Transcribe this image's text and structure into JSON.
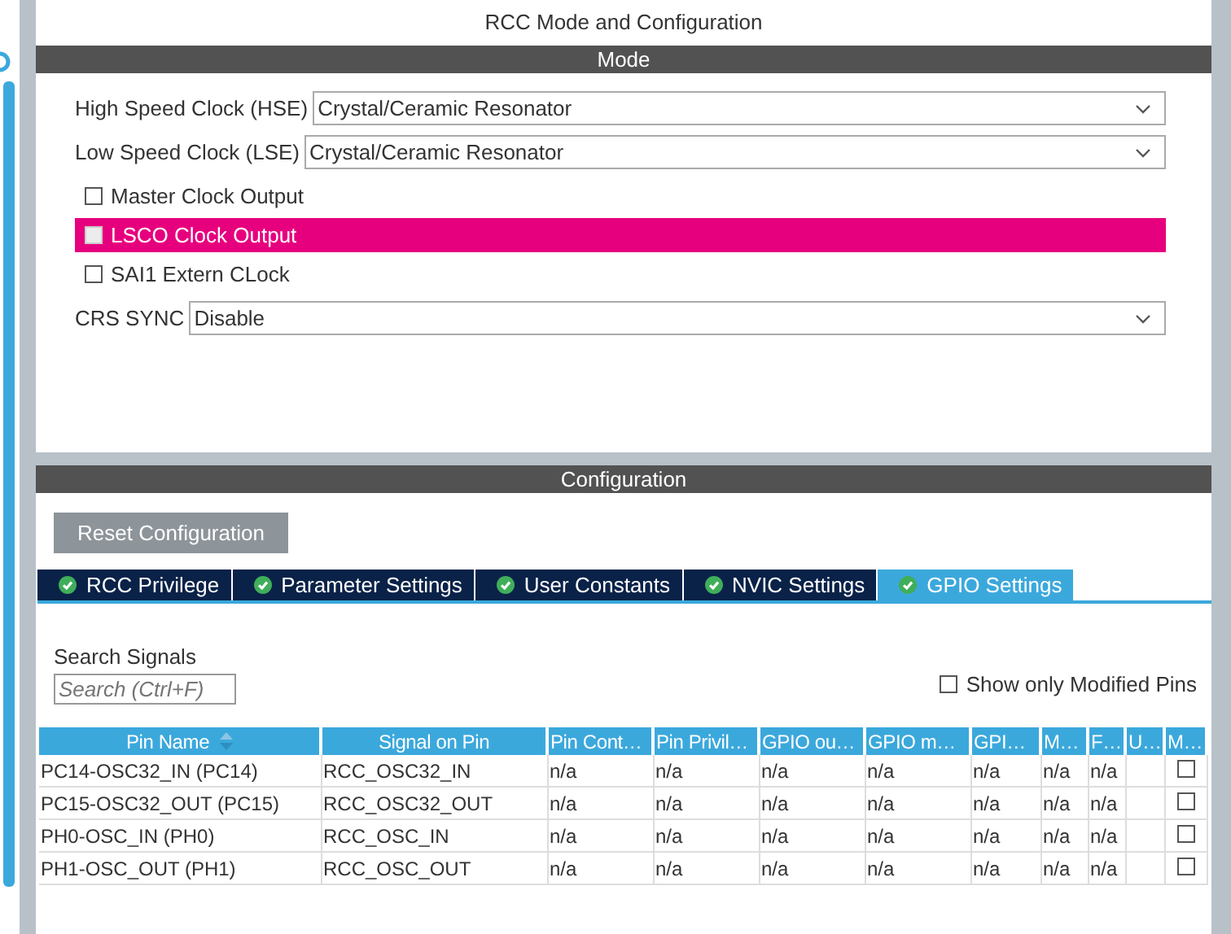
{
  "panel_title": "RCC Mode and Configuration",
  "mode": {
    "header": "Mode",
    "settings": [
      {
        "kind": "dropdown",
        "label": "High Speed Clock (HSE)",
        "value": "Crystal/Ceramic Resonator"
      },
      {
        "kind": "dropdown",
        "label": "Low Speed Clock (LSE)",
        "value": "Crystal/Ceramic Resonator"
      },
      {
        "kind": "checkbox",
        "label": "Master Clock Output",
        "checked": false,
        "highlighted": false
      },
      {
        "kind": "checkbox",
        "label": "LSCO Clock Output",
        "checked": false,
        "highlighted": true
      },
      {
        "kind": "checkbox",
        "label": "SAI1 Extern CLock",
        "checked": false,
        "highlighted": false
      },
      {
        "kind": "dropdown",
        "label": "CRS SYNC",
        "value": "Disable"
      }
    ]
  },
  "configuration": {
    "header": "Configuration",
    "reset_button": "Reset Configuration",
    "tabs": [
      {
        "label": "RCC Privilege",
        "selected": false
      },
      {
        "label": "Parameter Settings",
        "selected": false
      },
      {
        "label": "User Constants",
        "selected": false
      },
      {
        "label": "NVIC Settings",
        "selected": false
      },
      {
        "label": "GPIO Settings",
        "selected": true
      }
    ],
    "search": {
      "label": "Search Signals",
      "placeholder": "Search (Ctrl+F)"
    },
    "show_modified": {
      "label": "Show only Modified Pins",
      "checked": false
    },
    "table": {
      "columns": [
        "Pin Name",
        "Signal on Pin",
        "Pin Cont…",
        "Pin Privil…",
        "GPIO ou…",
        "GPIO m…",
        "GPI…",
        "M…",
        "F…",
        "U…",
        "M…"
      ],
      "rows": [
        {
          "cells": [
            "PC14-OSC32_IN (PC14)",
            "RCC_OSC32_IN",
            "n/a",
            "n/a",
            "n/a",
            "n/a",
            "n/a",
            "n/a",
            "n/a"
          ],
          "checked": false
        },
        {
          "cells": [
            "PC15-OSC32_OUT (PC15)",
            "RCC_OSC32_OUT",
            "n/a",
            "n/a",
            "n/a",
            "n/a",
            "n/a",
            "n/a",
            "n/a"
          ],
          "checked": false
        },
        {
          "cells": [
            "PH0-OSC_IN (PH0)",
            "RCC_OSC_IN",
            "n/a",
            "n/a",
            "n/a",
            "n/a",
            "n/a",
            "n/a",
            "n/a"
          ],
          "checked": false
        },
        {
          "cells": [
            "PH1-OSC_OUT (PH1)",
            "RCC_OSC_OUT",
            "n/a",
            "n/a",
            "n/a",
            "n/a",
            "n/a",
            "n/a",
            "n/a"
          ],
          "checked": false
        }
      ]
    }
  }
}
